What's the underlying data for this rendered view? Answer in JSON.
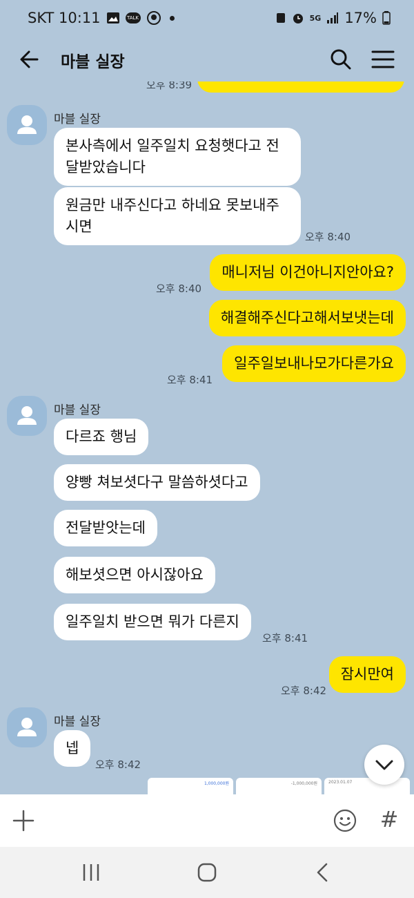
{
  "status_bar": {
    "carrier_time": "SKT 10:11",
    "talk_badge": "TALK",
    "network": "5G",
    "battery": "17%"
  },
  "header": {
    "title": "마블 실장"
  },
  "messages": {
    "partial_time": "오후 8:39",
    "sender1": "마블 실장",
    "m1": "본사측에서 일주일치 요청햇다고 전달받았습니다",
    "m2": "원금만 내주신다고 하네요 못보내주시면",
    "t1": "오후 8:40",
    "m3": "매니저님 이건아니지안아요?",
    "t2": "오후 8:40",
    "m4": "해결해주신다고해서보냇는데",
    "m5": "일주일보내나모가다른가요",
    "t3": "오후 8:41",
    "sender2": "마블 실장",
    "m6": "다르죠 행님",
    "m7": "양빵 쳐보셧다구 말씀하셧다고",
    "m8": "전달받앗는데",
    "m9": "해보셧으면 아시잖아요",
    "m10": "일주일치 받으면 뭐가 다른지",
    "t4": "오후 8:41",
    "m11": "잠시만여",
    "t5": "오후 8:42",
    "sender3": "마블 실장",
    "m12": "넵",
    "t6": "오후 8:42"
  },
  "thumbnails": {
    "a": "1,000,000원",
    "b": "-1,000,000원",
    "c": "2023.01.07"
  },
  "input_bar": {
    "hash": "#"
  }
}
